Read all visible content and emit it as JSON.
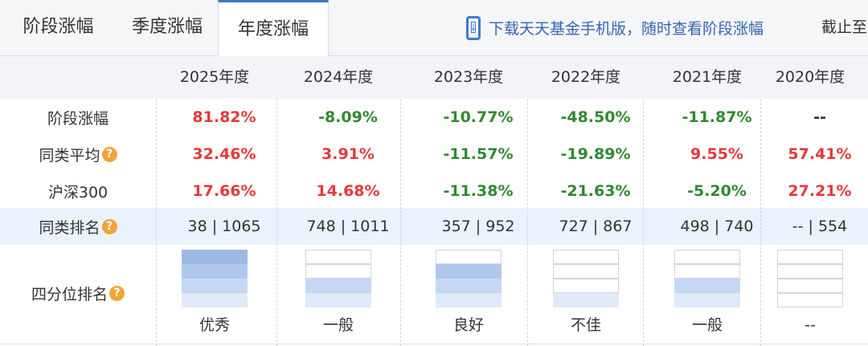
{
  "tabs": [
    {
      "label": "阶段涨幅",
      "active": false
    },
    {
      "label": "季度涨幅",
      "active": false
    },
    {
      "label": "年度涨幅",
      "active": true
    }
  ],
  "promo": {
    "text": "下载天天基金手机版，随时查看阶段涨幅",
    "icon": "mobile-download-icon"
  },
  "cutoff_text": "截止至",
  "years": [
    "2025年度",
    "2024年度",
    "2023年度",
    "2022年度",
    "2021年度",
    "2020年度"
  ],
  "rows": [
    {
      "label": "阶段涨幅",
      "help": false,
      "values": [
        "81.82%",
        "-8.09%",
        "-10.77%",
        "-48.50%",
        "-11.87%",
        "--"
      ]
    },
    {
      "label": "同类平均",
      "help": true,
      "values": [
        "32.46%",
        "3.91%",
        "-11.57%",
        "-19.89%",
        "9.55%",
        "57.41%"
      ]
    },
    {
      "label": "沪深300",
      "help": false,
      "values": [
        "17.66%",
        "14.68%",
        "-11.38%",
        "-21.63%",
        "-5.20%",
        "27.21%"
      ]
    }
  ],
  "rank_row": {
    "label": "同类排名",
    "help": true,
    "values": [
      "38 | 1065",
      "748 | 1011",
      "357 | 952",
      "727 | 867",
      "498 | 740",
      "-- | 554"
    ]
  },
  "quartile_row": {
    "label": "四分位排名",
    "help": true,
    "ratings": [
      "优秀",
      "一般",
      "良好",
      "不佳",
      "一般",
      "--"
    ],
    "filled_segments": [
      4,
      2,
      3,
      1,
      2,
      0
    ]
  },
  "colors": {
    "positive": "#e4393c",
    "negative": "#2f8a2f",
    "accent": "#3f79c5",
    "quartile_fills": [
      "#dfe9f8",
      "#c6d7f3",
      "#b0c7ed",
      "#9cb9e6"
    ]
  },
  "help_icon": "question-circle-icon"
}
